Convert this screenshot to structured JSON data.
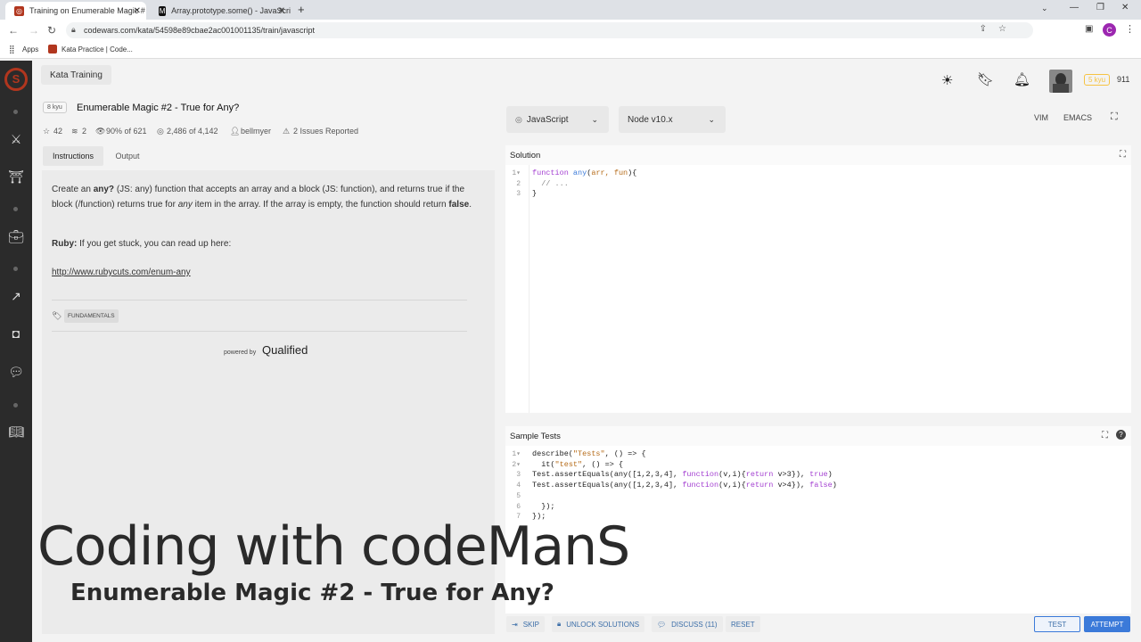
{
  "browser": {
    "tabs": [
      {
        "title": "Training on Enumerable Magic #"
      },
      {
        "title": "Array.prototype.some() - JavaScri"
      }
    ],
    "url": "codewars.com/kata/54598e89cbae2ac001001135/train/javascript",
    "bookmarks": [
      {
        "label": "Apps"
      },
      {
        "label": "Kata Practice | Code..."
      }
    ],
    "profile_initial": "C"
  },
  "header": {
    "section": "Kata Training",
    "rank_badge": "5 kyu",
    "honor": "911"
  },
  "kata": {
    "kyu": "8 kyu",
    "title": "Enumerable Magic #2 - True for Any?",
    "stars": "42",
    "collections": "2",
    "satisfaction": "90% of 621",
    "completed": "2,486 of 4,142",
    "author": "bellmyer",
    "issues": "2 Issues Reported"
  },
  "tabs": {
    "instructions": "Instructions",
    "output": "Output"
  },
  "description": {
    "p1_pre": "Create an ",
    "p1_any": "any?",
    "p1_mid": " (JS: any) function that accepts an array and a block (JS: function), and returns true if the block (/function) returns true for ",
    "p1_em": "any",
    "p1_post": " item in the array. If the array is empty, the function should return ",
    "p1_false": "false",
    "p1_end": ".",
    "ruby_label": "Ruby:",
    "ruby_text": " If you get stuck, you can read up here:",
    "link": "http://www.rubycuts.com/enum-any",
    "tag": "FUNDAMENTALS",
    "powered_by": "powered by",
    "qualified": "Qualified"
  },
  "editor": {
    "language": "JavaScript",
    "runtime": "Node v10.x",
    "vim": "VIM",
    "emacs": "EMACS",
    "solution_label": "Solution",
    "solution_lines": [
      "function any(arr, fun){",
      "  // ...",
      "}"
    ],
    "tests_label": "Sample Tests",
    "test_lines": [
      "describe(\"Tests\", () => {",
      "  it(\"test\", () => {",
      "Test.assertEquals(any([1,2,3,4], function(v,i){return v>3}), true)",
      "Test.assertEquals(any([1,2,3,4], function(v,i){return v>4}), false)",
      "",
      "  });",
      "});"
    ]
  },
  "footer": {
    "skip": "SKIP",
    "unlock": "UNLOCK SOLUTIONS",
    "discuss": "DISCUSS (11)",
    "reset": "RESET",
    "test": "TEST",
    "attempt": "ATTEMPT"
  },
  "overlay": {
    "channel": "Coding with codeManS",
    "episode": "Enumerable Magic #2 - True for Any?"
  },
  "colors": {
    "brand": "#b1361e",
    "accent": "#3b7ad9",
    "rank": "#f6c342"
  }
}
